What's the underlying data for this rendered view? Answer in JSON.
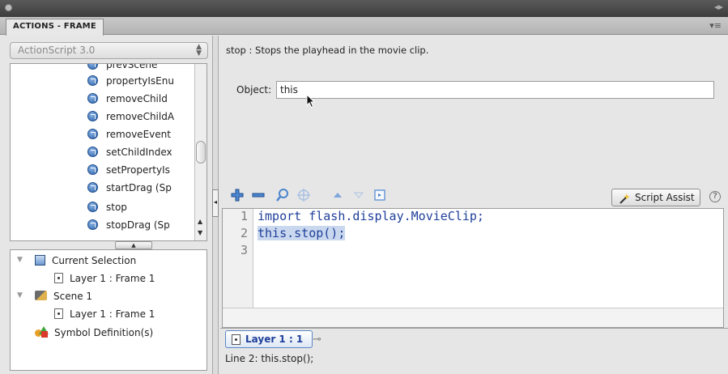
{
  "panel": {
    "tab_label": "ACTIONS - FRAME"
  },
  "toolbox": {
    "language": "ActionScript 3.0",
    "items": [
      {
        "label": "prevScene"
      },
      {
        "label": "propertyIsEnu"
      },
      {
        "label": "removeChild"
      },
      {
        "label": "removeChildA"
      },
      {
        "label": "removeEvent"
      },
      {
        "label": "setChildIndex"
      },
      {
        "label": "setPropertyIs"
      },
      {
        "label": "startDrag (Sp"
      },
      {
        "label": "stop"
      },
      {
        "label": "stopDrag (Sp"
      }
    ]
  },
  "navigator": {
    "items": [
      {
        "label": "Current Selection"
      },
      {
        "label": "Layer 1 : Frame 1"
      },
      {
        "label": "Scene 1"
      },
      {
        "label": "Layer 1 : Frame 1"
      },
      {
        "label": "Symbol Definition(s)"
      }
    ]
  },
  "assist": {
    "description": "stop : Stops the playhead in the movie clip.",
    "object_label": "Object:",
    "object_value": "this"
  },
  "toolbar": {
    "script_assist_label": "Script Assist",
    "help_glyph": "?"
  },
  "editor": {
    "line_numbers": [
      "1",
      "2",
      "3"
    ],
    "lines": [
      "import flash.display.MovieClip;",
      "this.stop();",
      ""
    ]
  },
  "status": {
    "layer_tab_label": "Layer 1 : 1",
    "line_info": "Line 2: this.stop();"
  }
}
